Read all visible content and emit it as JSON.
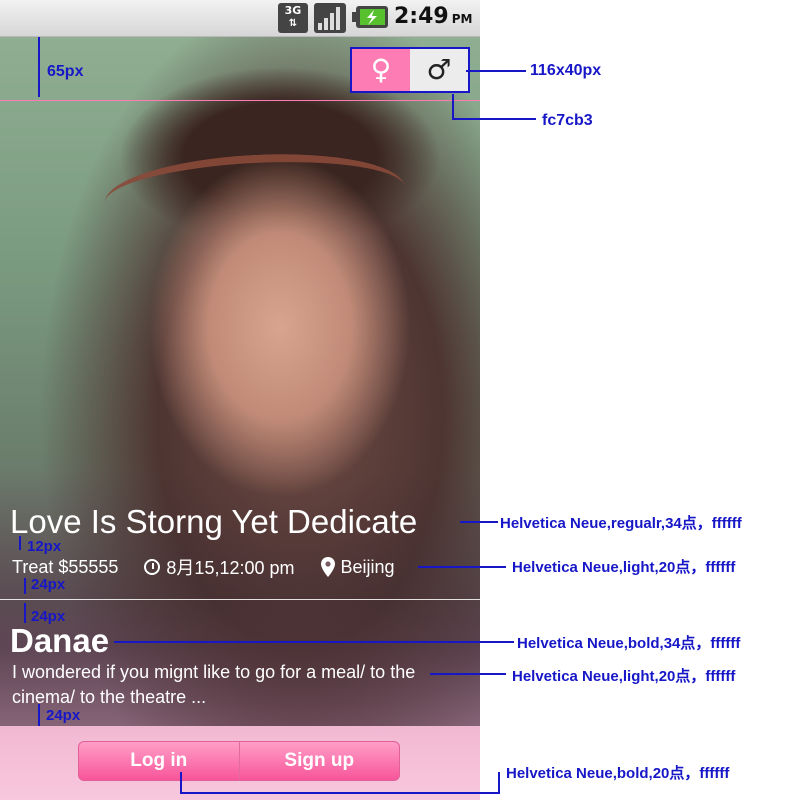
{
  "status_bar": {
    "network": "3G",
    "time": "2:49",
    "ampm": "PM"
  },
  "card": {
    "title": "Love Is Storng Yet Dedicate",
    "treat": "Treat $55555",
    "datetime": "8月15,12:00 pm",
    "location": "Beijing",
    "name": "Danae",
    "message": "I wondered if you mignt like to go for a meal/ to the cinema/ to the theatre ...",
    "login_label": "Log in",
    "signup_label": "Sign up"
  },
  "gender": {
    "female_symbol": "♀",
    "male_symbol": "♂"
  },
  "annotations": {
    "top_margin": "65px",
    "toggle_size": "116x40px",
    "toggle_color": "fc7cb3",
    "title_font": "Helvetica Neue,regualr,34点，ffffff",
    "gap_12": "12px",
    "meta_font": "Helvetica Neue,light,20点，ffffff",
    "gap_24_a": "24px",
    "gap_24_b": "24px",
    "name_font": "Helvetica Neue,bold,34点，ffffff",
    "message_font": "Helvetica Neue,light,20点，ffffff",
    "gap_24_c": "24px",
    "button_font": "Helvetica Neue,bold,20点，ffffff"
  },
  "colors": {
    "accent": "#fc7cb3",
    "annotation": "#1717c8"
  }
}
